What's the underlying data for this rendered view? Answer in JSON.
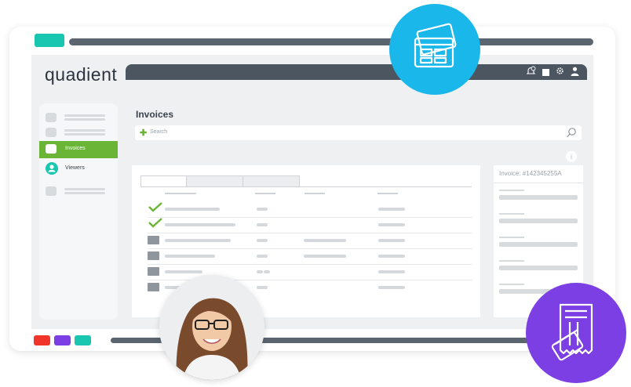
{
  "app": {
    "logo_text": "quadient"
  },
  "header": {
    "icons": [
      "bell-clock-icon",
      "square-icon",
      "settings-icon",
      "user-icon"
    ]
  },
  "sidebar": {
    "items": [
      {
        "label": "",
        "state": "placeholder"
      },
      {
        "label": "",
        "state": "placeholder"
      },
      {
        "label": "Invoices",
        "state": "active"
      },
      {
        "label": "Viewers",
        "state": "normal"
      },
      {
        "label": "",
        "state": "placeholder"
      }
    ]
  },
  "main": {
    "title": "Invoices",
    "search": {
      "placeholder": "Search"
    },
    "info_label": "i"
  },
  "table": {
    "tabs": [
      "",
      "",
      ""
    ],
    "rows": [
      {
        "kind": "approved"
      },
      {
        "kind": "approved"
      },
      {
        "kind": "folder"
      },
      {
        "kind": "folder"
      },
      {
        "kind": "folder"
      },
      {
        "kind": "folder"
      }
    ]
  },
  "detail": {
    "title": "Invoice:  #142345255A"
  },
  "colors": {
    "accent_green": "#6ab535",
    "teal": "#19c6b0",
    "badge_blue": "#1ab7ea",
    "badge_purple": "#7b3fe4",
    "dark_bar": "#4c5661",
    "bottom_dots": [
      "#f0362b",
      "#7b3fe4",
      "#19c6b0"
    ]
  },
  "badges": {
    "top": "credit-cards-icon",
    "bottom": "invoice-card-icon"
  }
}
